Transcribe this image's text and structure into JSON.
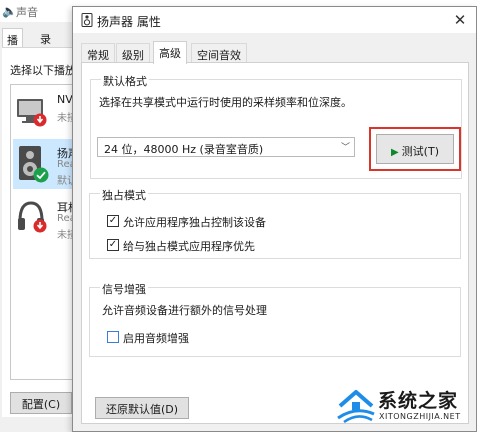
{
  "colors": {
    "selection": "#cce8ff",
    "highlight_box": "#d9352b",
    "play_icon": "#0a8a2a",
    "watermark_blue": "#1f8de8"
  },
  "sound_window": {
    "title": "声音",
    "tabs": [
      {
        "label": "播放",
        "active": true
      },
      {
        "label": "录制",
        "active": false
      }
    ],
    "hint": "选择以下播放",
    "devices": [
      {
        "name": "NV",
        "sub": [
          "未接"
        ],
        "icon": "monitor-icon",
        "badge": "disabled-badge-icon"
      },
      {
        "name": "扬声",
        "sub": [
          "Rea",
          "默认"
        ],
        "icon": "speaker-icon",
        "badge": "default-check-icon",
        "selected": true
      },
      {
        "name": "耳机",
        "sub": [
          "Rea",
          "未接"
        ],
        "icon": "headphones-icon",
        "badge": "disabled-badge-icon"
      }
    ],
    "configure_button": "配置(C)"
  },
  "dialog": {
    "title": "扬声器 属性",
    "close_glyph": "✕",
    "tabs": [
      {
        "label": "常规",
        "active": false
      },
      {
        "label": "级别",
        "active": false
      },
      {
        "label": "高级",
        "active": true
      },
      {
        "label": "空间音效",
        "active": false
      }
    ],
    "default_format": {
      "label": "默认格式",
      "description": "选择在共享模式中运行时使用的采样频率和位深度。",
      "selected_format": "24 位，48000 Hz (录音室音质)",
      "test_button": "测试(T)"
    },
    "exclusive_mode": {
      "label": "独占模式",
      "options": [
        {
          "label": "允许应用程序独占控制该设备",
          "checked": true
        },
        {
          "label": "给与独占模式应用程序优先",
          "checked": true
        }
      ]
    },
    "signal_enhancement": {
      "label": "信号增强",
      "description": "允许音频设备进行额外的信号处理",
      "options": [
        {
          "label": "启用音频增强",
          "checked": false
        }
      ]
    },
    "restore_defaults_button": "还原默认值(D)"
  },
  "watermark": {
    "name": "系统之家",
    "url": "XITONGZHIJIA.NET"
  }
}
